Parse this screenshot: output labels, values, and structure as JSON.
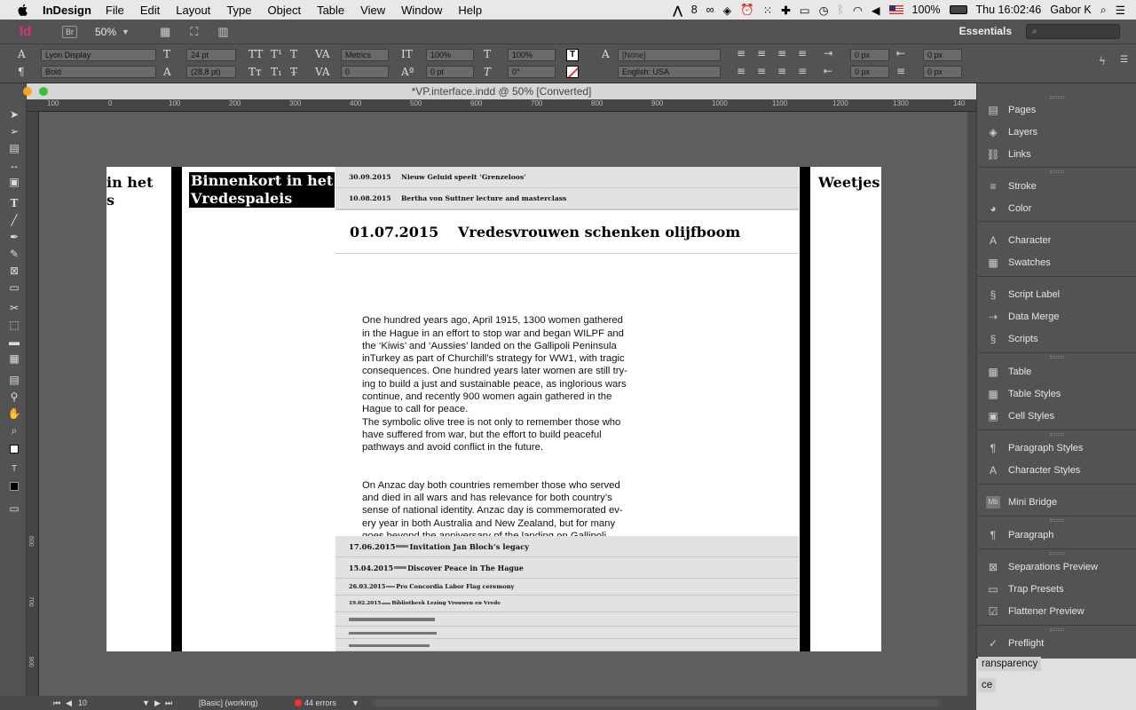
{
  "menubar": {
    "app_name": "InDesign",
    "items": [
      "File",
      "Edit",
      "Layout",
      "Type",
      "Object",
      "Table",
      "View",
      "Window",
      "Help"
    ],
    "adobe_count": "8",
    "battery": "100%",
    "clock": "Thu 16:02:46",
    "user": "Gabor K"
  },
  "control_panel": {
    "logo": "Id",
    "bridge": "Br",
    "zoom": "50%",
    "workspace": "Essentials",
    "font_family": "Lyon Display",
    "font_style": "Bold",
    "font_size": "24 pt",
    "leading": "(28,8 pt)",
    "kerning": "Metrics",
    "tracking": "0",
    "vertical_scale": "100%",
    "horizontal_scale": "100%",
    "baseline_shift": "0 pt",
    "skew": "0°",
    "char_style": "[None]",
    "language": "English: USA",
    "indent_left": "0 px",
    "indent_right": "0 px",
    "indent_first": "0 px",
    "indent_last": "0 px"
  },
  "document": {
    "title": "*VP.interface.indd @ 50% [Converted]",
    "ruler_ticks": [
      "100",
      "0",
      "100",
      "200",
      "300",
      "400",
      "500",
      "600",
      "700",
      "800",
      "900",
      "1000",
      "1100",
      "1200",
      "1300",
      "140"
    ],
    "vruler_ticks": [
      "600",
      "700",
      "800"
    ]
  },
  "spread": {
    "left_heading": "in het\ns",
    "section_title_line1": "Binnenkort in het",
    "section_title_line2": "Vredespaleis",
    "top_news": [
      {
        "date": "30.09.2015",
        "title": "Nieuw Geluid speelt ‘Grenzeloos’"
      },
      {
        "date": "10.08.2015",
        "title": "Bertha von Suttner lecture and masterclass"
      }
    ],
    "main_date": "01.07.2015",
    "main_title": "Vredesvrouwen schenken olijfboom",
    "body_paragraph_1": "One hundred years ago, April 1915, 1300 women gathered\nin the Hague in an effort to stop war and began WILPF and\nthe ‘Kiwis’ and ‘Aussies’ landed on the Gallipoli Peninsula\ninTurkey as part of Churchill’s strategy for WW1, with tragic\nconsequences. One hundred years later women are still try-\ning to build a just and sustainable peace, as inglorious wars\ncontinue, and recently 900 women again gathered in the\nHague to call for peace.\nThe symbolic olive tree is not only to remember those who\nhave suffered from war, but the effort to build peaceful\npathways and avoid conflict in the future.",
    "body_paragraph_2": "On Anzac day both countries remember those who served\nand died in all wars and has relevance for both country’s\nsense of national identity. Anzac day is commemorated ev-\nery year in both Australia and New Zealand, but for many\ngoes beyond the anniversary of the landing on Gallipoli.",
    "list": [
      {
        "date": "17.06.2015",
        "title": "Invitation Jan Bloch’s legacy"
      },
      {
        "date": "15.04.2015",
        "title": "Discover Peace in The Hague"
      },
      {
        "date": "26.03.2015",
        "title": "Pro Concordia Labor Flag ceremony"
      },
      {
        "date": "19.02.2015",
        "title": "Bibliotheek Lezing Vrouwen en Vrede"
      }
    ],
    "right_heading": "Weetjes"
  },
  "statusbar": {
    "page": "10",
    "style": "[Basic] (working)",
    "errors": "44 errors"
  },
  "dock": {
    "groups": [
      [
        "Pages",
        "Layers",
        "Links"
      ],
      [
        "Stroke",
        "Color"
      ],
      [
        "Character",
        "Swatches"
      ],
      [
        "Script Label",
        "Data Merge",
        "Scripts"
      ],
      [
        "Table",
        "Table Styles",
        "Cell Styles"
      ],
      [
        "Paragraph Styles",
        "Character Styles"
      ],
      [
        "Mini Bridge"
      ],
      [
        "Paragraph"
      ],
      [
        "Separations Preview",
        "Trap Presets",
        "Flattener Preview"
      ],
      [
        "Preflight"
      ]
    ],
    "under_items": [
      "ransparency",
      "ce"
    ]
  },
  "colors": {
    "indesign_pink": "#d8307a",
    "panel": "#535353",
    "error_red": "#e33"
  }
}
